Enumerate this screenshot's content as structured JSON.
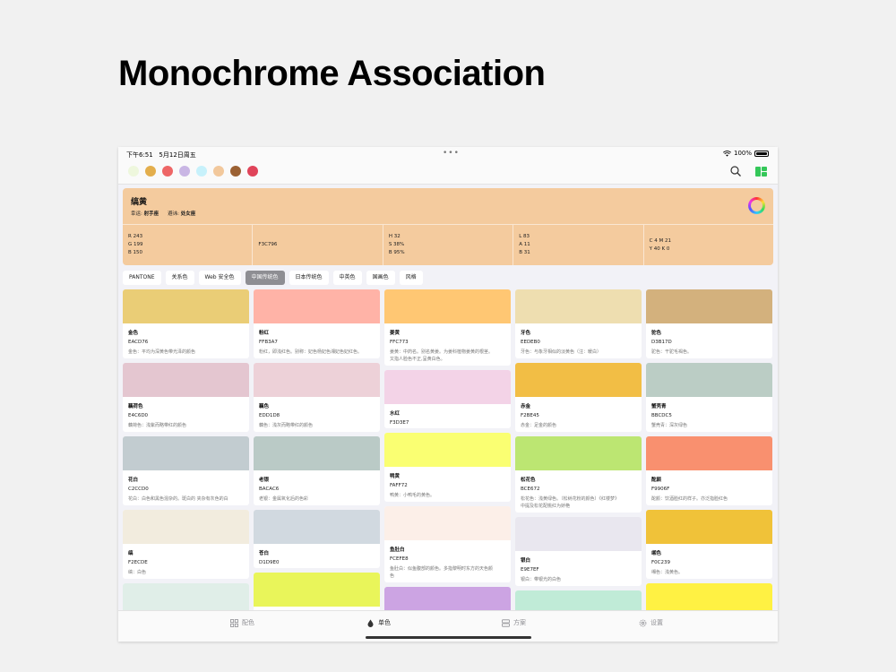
{
  "headline": "Monochrome Association",
  "status": {
    "time": "下午6:51",
    "date": "5月12日周五",
    "battery": "100%"
  },
  "palette_dots": [
    "#eef7dd",
    "#e3ae4c",
    "#ee6666",
    "#c9b6e4",
    "#c7f1fb",
    "#f2c89c",
    "#9b6133",
    "#e0445a"
  ],
  "detail": {
    "name": "缟黄",
    "color": "#f3c796",
    "lucky_label": "幸运:",
    "lucky_value": "射手座",
    "avoid_label": "避讳:",
    "avoid_value": "处女座",
    "rgb": [
      "R 243",
      "G 199",
      "B 150"
    ],
    "hex": "F3C796",
    "hsb": [
      "H 32",
      "S 38%",
      "B 95%"
    ],
    "lab": [
      "L 83",
      "A 11",
      "B 31"
    ],
    "cmyk": [
      "C 4  M 21",
      "Y 40  K 0"
    ]
  },
  "filters": [
    "PANTONE",
    "关系色",
    "Web 安全色",
    "中国传统色",
    "日本传统色",
    "中英色",
    "国画色",
    "风格"
  ],
  "active_filter": 3,
  "columns": [
    [
      {
        "name": "金色",
        "hex": "EACD76",
        "color": "#eacd76",
        "desc": [
          "金色：平均为深黄色带光泽的颜色"
        ]
      },
      {
        "name": "藕荷色",
        "hex": "E4C6D0",
        "color": "#e4c6d0",
        "desc": [
          "藕荷色：浅紫而略带红的颜色"
        ]
      },
      {
        "name": "花白",
        "hex": "C2CCD0",
        "color": "#c2ccd0",
        "desc": [
          "花白：白色和黑色混杂的。斑白的 夹杂有灰色的白"
        ]
      },
      {
        "name": "缟",
        "hex": "F2ECDE",
        "color": "#f2ecde",
        "desc": [
          "缟：白色"
        ]
      },
      {
        "name": "",
        "hex": "",
        "color": "#e0eee8",
        "desc": []
      }
    ],
    [
      {
        "name": "粉红",
        "hex": "FFB3A7",
        "color": "#ffb3a7",
        "desc": [
          "粉红，即浅红色。别称：妃色杨妃色湘妃色妃红色。"
        ]
      },
      {
        "name": "藕色",
        "hex": "EDD1D8",
        "color": "#edd1d8",
        "desc": [
          "藕色：浅灰而略带红的颜色"
        ]
      },
      {
        "name": "老银",
        "hex": "BACAC6",
        "color": "#bacac6",
        "desc": [
          "老银：金属氧化后的色彩"
        ]
      },
      {
        "name": "苍白",
        "hex": "D1D9E0",
        "color": "#d1d9e0",
        "desc": []
      },
      {
        "name": "",
        "hex": "",
        "color": "#e9f55a",
        "desc": []
      }
    ],
    [
      {
        "name": "姜黄",
        "hex": "FFC773",
        "color": "#ffc773",
        "desc": [
          "姜黄：中药名。别名黄姜。为姜科植物姜黄的根茎。",
          "又指人脸色不正,呈黄白色。"
        ]
      },
      {
        "name": "水红",
        "hex": "F3D3E7",
        "color": "#f3d3e7",
        "desc": []
      },
      {
        "name": "鸭黄",
        "hex": "FAFF72",
        "color": "#faff72",
        "desc": [
          "鸭黄：小鸭毛的黄色。"
        ]
      },
      {
        "name": "鱼肚白",
        "hex": "FCEFE8",
        "color": "#fcefe8",
        "desc": [
          "鱼肚白：似鱼腹部的颜色。多指黎明时东方的天色颜",
          "色"
        ]
      },
      {
        "name": "",
        "hex": "",
        "color": "#cca4e3",
        "desc": []
      }
    ],
    [
      {
        "name": "牙色",
        "hex": "EEDEB0",
        "color": "#eedeb0",
        "desc": [
          "牙色：与象牙相似的淡黄色（注：暖白）"
        ]
      },
      {
        "name": "赤金",
        "hex": "F2BE45",
        "color": "#f2be45",
        "desc": [
          "赤金：足金的颜色"
        ]
      },
      {
        "name": "松花色",
        "hex": "BCE672",
        "color": "#bce672",
        "desc": [
          "松花色：浅黄绿色。（松树花粉的颜色）《红楼梦》",
          "中提及松花配桃红为娇艳"
        ]
      },
      {
        "name": "银白",
        "hex": "E9E7EF",
        "color": "#e9e7ef",
        "desc": [
          "银白：带银光的白色"
        ]
      },
      {
        "name": "",
        "hex": "",
        "color": "#c0ebd7",
        "desc": []
      }
    ],
    [
      {
        "name": "驼色",
        "hex": "D3B17D",
        "color": "#d3b17d",
        "desc": [
          "驼色：干驼毛褐色。"
        ]
      },
      {
        "name": "蟹壳青",
        "hex": "BBCDC5",
        "color": "#bbcdc5",
        "desc": [
          "蟹壳青：深灰绿色"
        ]
      },
      {
        "name": "酡颜",
        "hex": "F9906F",
        "color": "#f9906f",
        "desc": [
          "酡颜：饮酒脸红的样子。亦泛指脸红色"
        ]
      },
      {
        "name": "缃色",
        "hex": "F0C239",
        "color": "#f0c239",
        "desc": [
          "缃色：浅黄色。"
        ]
      },
      {
        "name": "",
        "hex": "",
        "color": "#fff143",
        "desc": []
      }
    ]
  ],
  "tabs": [
    {
      "label": "配色",
      "icon": "grid-icon"
    },
    {
      "label": "单色",
      "icon": "drop-icon"
    },
    {
      "label": "方案",
      "icon": "stack-icon"
    },
    {
      "label": "设置",
      "icon": "gear-icon"
    }
  ],
  "active_tab": 1
}
